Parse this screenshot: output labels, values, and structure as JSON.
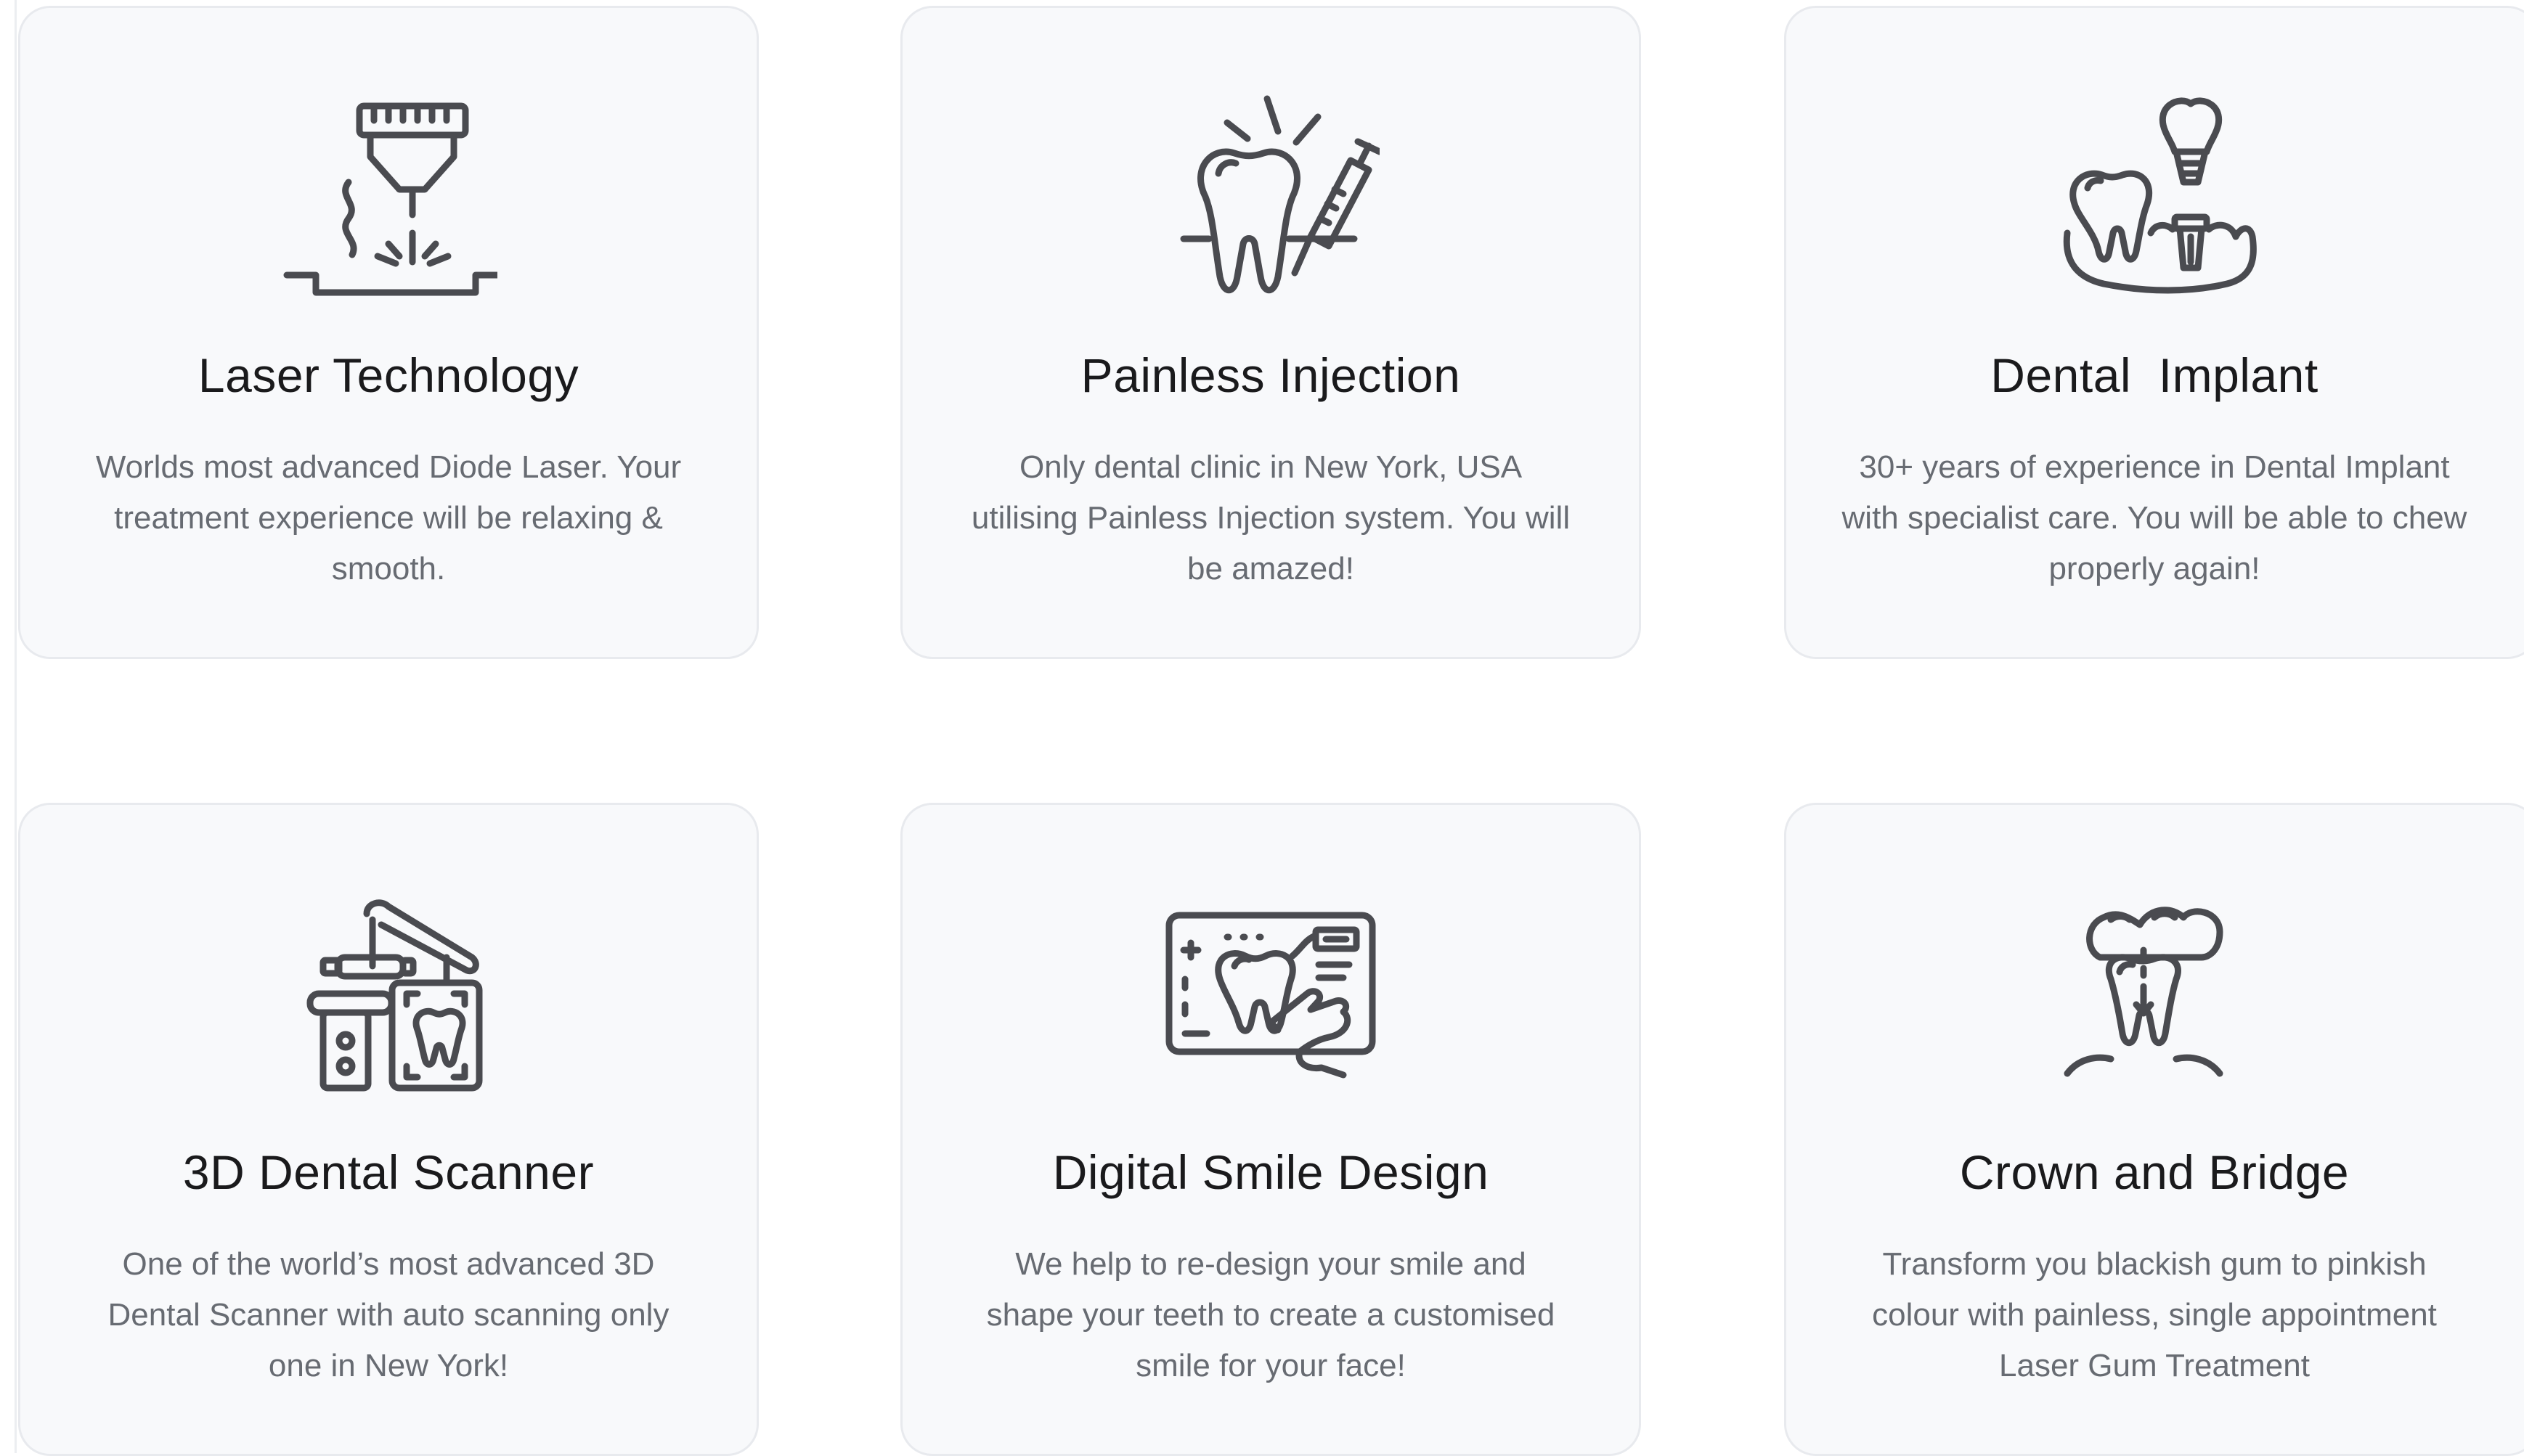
{
  "colors": {
    "card_background": "#f8f9fb",
    "card_border": "#e8eaee",
    "title_text": "#1a1a1c",
    "description_text": "#676b72",
    "icon_stroke": "#4a4b50"
  },
  "features": [
    {
      "icon": "laser-icon",
      "title": "Laser Technology",
      "description": "Worlds most advanced Diode Laser. Your treatment experience will be relaxing & smooth."
    },
    {
      "icon": "tooth-injection-icon",
      "title": "Painless Injection",
      "description": "Only dental clinic in New York, USA utilising Painless Injection system. You will be amazed!"
    },
    {
      "icon": "dental-implant-icon",
      "title": "Dental  Implant",
      "description": "30+ years of experience in Dental Implant with specialist care. You will be able to chew properly again!"
    },
    {
      "icon": "dental-scanner-icon",
      "title": "3D Dental Scanner",
      "description": "One of the world’s most advanced 3D Dental Scanner with auto scanning only one in New York!"
    },
    {
      "icon": "smile-design-icon",
      "title": "Digital Smile Design",
      "description": "We help to re-design your smile and shape your teeth to create a customised smile for your face!"
    },
    {
      "icon": "crown-bridge-icon",
      "title": "Crown and Bridge",
      "description": "Transform you blackish gum to pinkish colour with painless, single appointment Laser Gum Treatment"
    }
  ]
}
